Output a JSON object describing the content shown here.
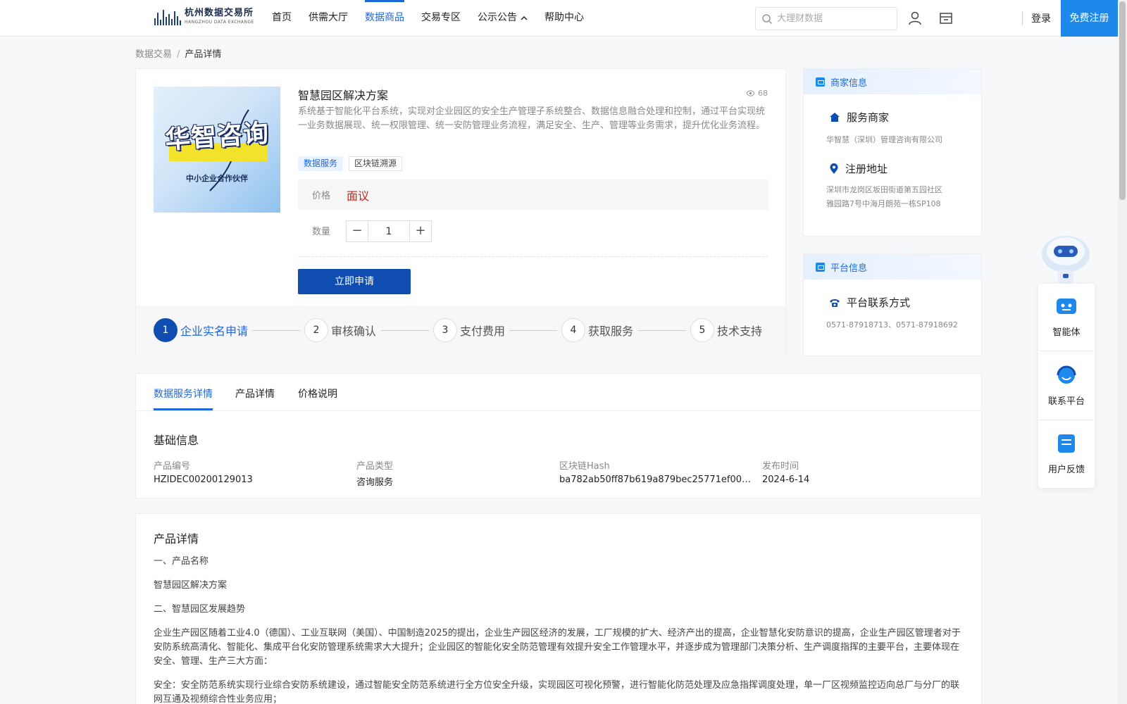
{
  "header": {
    "logo_cn": "杭州数据交易所",
    "logo_en": "HANGZHOU DATA EXCHANGE",
    "nav": [
      {
        "label": "首页",
        "active": false
      },
      {
        "label": "供需大厅",
        "active": false
      },
      {
        "label": "数据商品",
        "active": true
      },
      {
        "label": "交易专区",
        "active": false
      },
      {
        "label": "公示公告",
        "active": false
      },
      {
        "label": "帮助中心",
        "active": false
      }
    ],
    "search_placeholder": "大理财数据",
    "login": "登录",
    "register": "免费注册"
  },
  "breadcrumb": {
    "root": "数据交易",
    "sep": "/",
    "current": "产品详情"
  },
  "product": {
    "image": {
      "title": "华智咨询",
      "subtitle": "中小企业合作伙伴"
    },
    "title": "智慧园区解决方案",
    "views": "68",
    "description": "系统基于智能化平台系统，实现对企业园区的安全生产管理子系统整合、数据信息融合处理和控制，通过平台实现统一业务数据展现、统一权限管理、统一安防管理业务流程，满足安全、生产、管理等业务需求，提升优化业务流程。",
    "tags": [
      "数据服务",
      "区块链溯源"
    ],
    "price_label": "价格",
    "price_value": "面议",
    "qty_label": "数量",
    "qty_value": "1",
    "apply_button": "立即申请"
  },
  "steps": [
    {
      "num": "1",
      "label": "企业实名申请",
      "active": true
    },
    {
      "num": "2",
      "label": "审核确认",
      "active": false
    },
    {
      "num": "3",
      "label": "支付费用",
      "active": false
    },
    {
      "num": "4",
      "label": "获取服务",
      "active": false
    },
    {
      "num": "5",
      "label": "技术支持",
      "active": false
    }
  ],
  "merchant": {
    "header": "商家信息",
    "service_label": "服务商家",
    "service_value": "华智慧（深圳）管理咨询有限公司",
    "address_label": "注册地址",
    "address_line1": "深圳市龙岗区坂田街道第五园社区",
    "address_line2": "雅园路7号中海月朗苑一栋SP108"
  },
  "platform": {
    "header": "平台信息",
    "contact_label": "平台联系方式",
    "contact_value": "0571-87918713、0571-87918692"
  },
  "tabs": [
    "数据服务详情",
    "产品详情",
    "价格说明"
  ],
  "basic_info": {
    "title": "基础信息",
    "fields": [
      {
        "label": "产品编号",
        "value": "HZIDEC00200129013"
      },
      {
        "label": "产品类型",
        "value": "咨询服务"
      },
      {
        "label": "区块链Hash",
        "value": "ba782ab50ff87b619a879bec25771ef0078..."
      },
      {
        "label": "发布时间",
        "value": "2024-6-14"
      }
    ]
  },
  "product_detail": {
    "title": "产品详情",
    "paragraphs": [
      "一、产品名称",
      "智慧园区解决方案",
      "二、智慧园区发展趋势",
      "企业生产园区随着工业4.0（德国）、工业互联网（美国）、中国制造2025的提出，企业生产园区经济的发展，工厂规模的扩大、经济产出的提高，企业智慧化安防意识的提高，企业生产园区管理者对于安防系统高清化、智能化、集成平台化安防管理系统需求大大提升；企业园区的智能化安全防范管理有效提升安全工作管理水平，并逐步成为管理部门决策分析、生产调度指挥的主要平台，主要体现在安全、管理、生产三大方面：",
      "安全：安全防范系统实现行业综合安防系统建设，通过智能安全防范系统进行全方位安全升级，实现园区可视化预警，进行智能化防范处理及应急指挥调度处理，单一厂区视频监控迈向总厂与分厂的联网互通及视频综合性业务应用；"
    ]
  },
  "float_widget": {
    "items": [
      "智能体",
      "联系平台",
      "用户反馈"
    ]
  }
}
